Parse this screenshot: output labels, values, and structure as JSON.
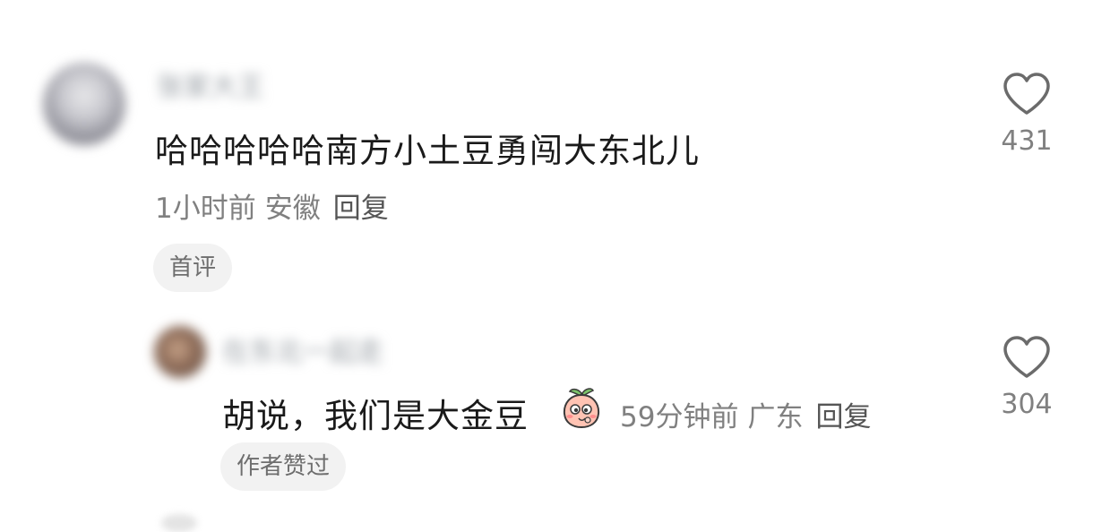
{
  "comments": [
    {
      "username": "张家大王",
      "text": "哈哈哈哈哈南方小土豆勇闯大东北儿",
      "time": "1小时前",
      "location": "安徽",
      "reply_label": "回复",
      "tag": "首评",
      "likes": "431"
    },
    {
      "username": "在东北一起走",
      "text": "胡说，我们是大金豆",
      "time": "59分钟前",
      "location": "广东",
      "reply_label": "回复",
      "tag": "作者赞过",
      "likes": "304",
      "emoji_icon": "peach-face-sticker"
    }
  ],
  "colors": {
    "text": "#1a1a1a",
    "meta": "#808080",
    "tag_bg": "#f2f2f2"
  }
}
